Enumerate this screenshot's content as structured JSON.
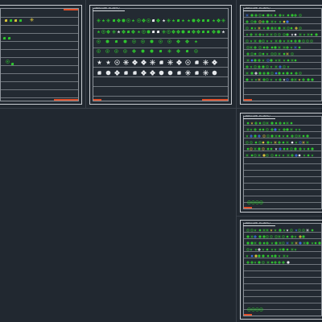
{
  "canvas": {
    "background": "#212830",
    "sheet_border": "#c9cdd2",
    "accent_red": "#e0502a",
    "plant_green": "#2ec42e",
    "plant_white": "#e6e9ec",
    "plant_blue": "#3a6fe0",
    "plant_yellow": "#d8c23a"
  },
  "sheets": [
    {
      "id": "sheet-1",
      "title": ""
    },
    {
      "id": "sheet-2",
      "title": "LANDSCAPE PLANTS/"
    },
    {
      "id": "sheet-3",
      "title": "LANDSCAPE PLANTS/"
    },
    {
      "id": "sheet-4",
      "title": "LANDSCAPE PLANTS/"
    },
    {
      "id": "sheet-5",
      "title": "LANDSCAPE PLANTS/"
    }
  ],
  "icons": {
    "tree": "tree-symbol-icon",
    "shrub": "shrub-symbol-icon",
    "flower": "flower-symbol-icon",
    "star": "star-symbol-icon",
    "circle": "circle-symbol-icon"
  }
}
